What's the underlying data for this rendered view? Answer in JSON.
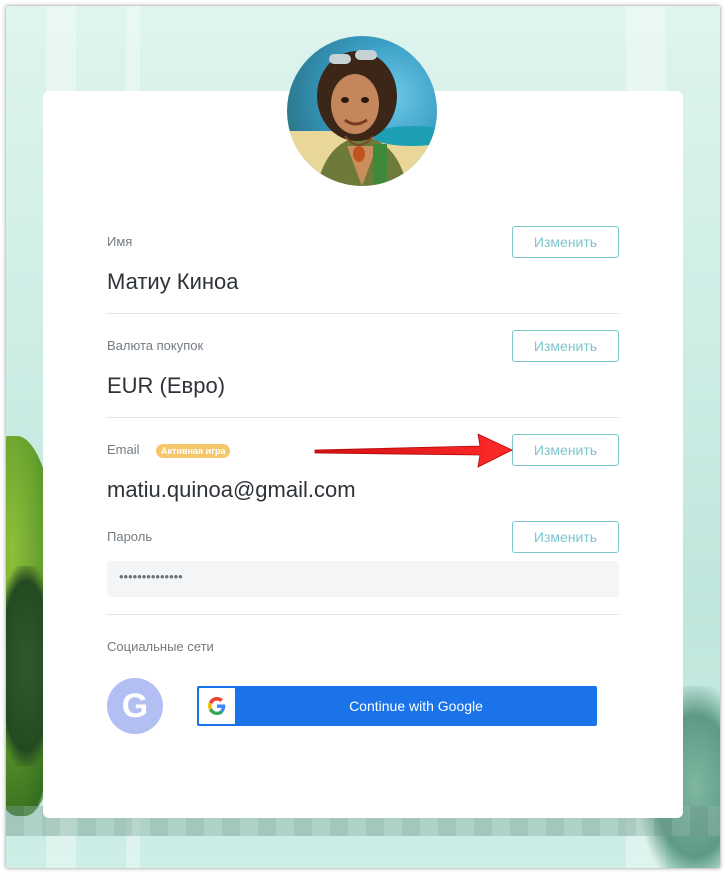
{
  "profile": {
    "name_label": "Имя",
    "name_value": "Матиу Киноа",
    "currency_label": "Валюта покупок",
    "currency_value": "EUR (Евро)",
    "email_label": "Email",
    "email_badge": "Активная игра",
    "email_value": "matiu.quinoa@gmail.com",
    "password_label": "Пароль",
    "password_value": "••••••••••••••",
    "edit_label": "Изменить"
  },
  "social": {
    "label": "Социальные сети",
    "google_letter": "G",
    "google_button": "Continue with Google"
  },
  "colors": {
    "accent": "#7bc6cf",
    "google_blue": "#1a73e8",
    "badge": "#f6c66a",
    "arrow": "#e8191a"
  }
}
